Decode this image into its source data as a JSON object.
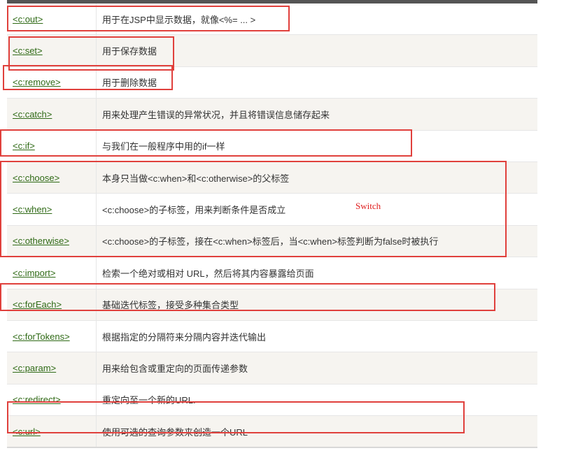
{
  "rows": [
    {
      "tag": "<c:out>",
      "description": "用于在JSP中显示数据，就像<%= ... >"
    },
    {
      "tag": "<c:set>",
      "description": "用于保存数据"
    },
    {
      "tag": "<c:remove>",
      "description": "用于删除数据"
    },
    {
      "tag": "<c:catch>",
      "description": "用来处理产生错误的异常状况，并且将错误信息储存起来"
    },
    {
      "tag": "<c:if>",
      "description": "与我们在一般程序中用的if一样"
    },
    {
      "tag": "<c:choose>",
      "description": "本身只当做<c:when>和<c:otherwise>的父标签"
    },
    {
      "tag": "<c:when>",
      "description": "<c:choose>的子标签，用来判断条件是否成立"
    },
    {
      "tag": "<c:otherwise>",
      "description": "<c:choose>的子标签，接在<c:when>标签后，当<c:when>标签判断为false时被执行"
    },
    {
      "tag": "<c:import>",
      "description": "检索一个绝对或相对 URL，然后将其内容暴露给页面"
    },
    {
      "tag": "<c:forEach>",
      "description": "基础迭代标签，接受多种集合类型"
    },
    {
      "tag": "<c:forTokens>",
      "description": "根据指定的分隔符来分隔内容并迭代输出"
    },
    {
      "tag": "<c:param>",
      "description": "用来给包含或重定向的页面传递参数"
    },
    {
      "tag": "<c:redirect>",
      "description": "重定向至一个新的URL."
    },
    {
      "tag": "<c:url>",
      "description": "使用可选的查询参数来创造一个URL"
    }
  ],
  "annotation": "Switch",
  "colors": {
    "link": "#2f6a16",
    "highlight": "#e0403c",
    "annotation": "#e02020",
    "header": "#555555",
    "row_alt": "#f6f4f0"
  }
}
